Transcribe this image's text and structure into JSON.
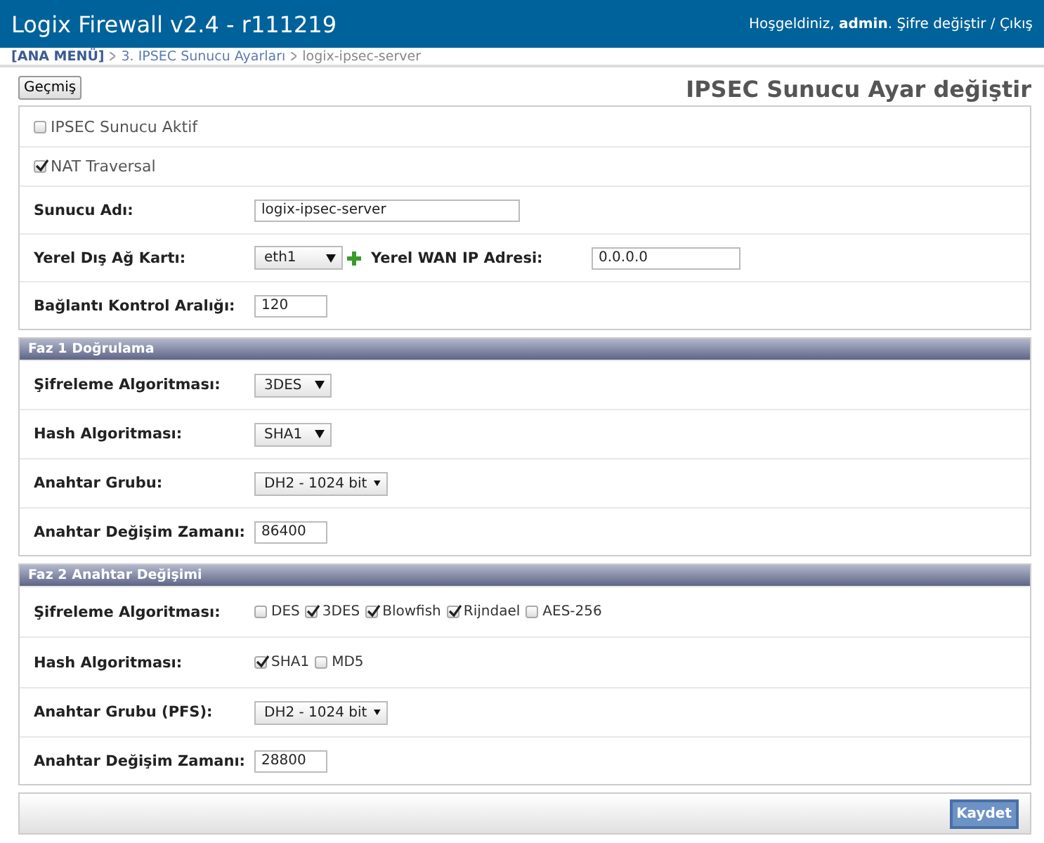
{
  "header": {
    "title": "Logix Firewall v2.4 - r111219",
    "greeting": "Hoşgeldiniz, ",
    "user": "admin",
    "user_suffix": ".",
    "change_password": "Şifre değiştir",
    "separator": "/",
    "logout": "Çıkış"
  },
  "breadcrumb": [
    {
      "label": "[ANA MENÜ]",
      "kind": "root"
    },
    {
      "label": "3. IPSEC Sunucu Ayarları",
      "kind": "link"
    },
    {
      "label": "logix-ipsec-server",
      "kind": "current"
    }
  ],
  "history_button": "Geçmiş",
  "page_title": "IPSEC Sunucu Ayar değiştir",
  "sections": [
    {
      "rows": [
        {
          "kind": "checkbox",
          "label": "IPSEC Sunucu Aktif",
          "checked": false
        },
        {
          "kind": "checkbox",
          "label": "NAT Traversal",
          "checked": true
        },
        {
          "kind": "text",
          "label": "Sunucu Adı:",
          "value": "logix-ipsec-server"
        },
        {
          "kind": "select_pair",
          "label": "Yerel Dış Ağ Kartı:",
          "value": "eth1",
          "second_label": "Yerel WAN IP Adresi:",
          "second_value": "0.0.0.0"
        },
        {
          "kind": "text",
          "label": "Bağlantı Kontrol Aralığı:",
          "value": "120"
        }
      ]
    },
    {
      "title": "Faz 1 Doğrulama",
      "rows": [
        {
          "kind": "select",
          "label": "Şifreleme Algoritması:",
          "value": "3DES"
        },
        {
          "kind": "select",
          "label": "Hash Algoritması:",
          "value": "SHA1"
        },
        {
          "kind": "select",
          "label": "Anahtar Grubu:",
          "value": "DH2 - 1024 bit"
        },
        {
          "kind": "text",
          "label": "Anahtar Değişim Zamanı:",
          "value": "86400"
        }
      ]
    },
    {
      "title": "Faz 2 Anahtar Değişimi",
      "rows": [
        {
          "kind": "checks",
          "label": "Şifreleme Algoritması:",
          "options": [
            {
              "label": "DES",
              "checked": false
            },
            {
              "label": "3DES",
              "checked": true
            },
            {
              "label": "Blowfish",
              "checked": true
            },
            {
              "label": "Rijndael",
              "checked": true
            },
            {
              "label": "AES-256",
              "checked": false
            }
          ]
        },
        {
          "kind": "checks",
          "label": "Hash Algoritması:",
          "options": [
            {
              "label": "SHA1",
              "checked": true
            },
            {
              "label": "MD5",
              "checked": false
            }
          ]
        },
        {
          "kind": "select",
          "label": "Anahtar Grubu (PFS):",
          "value": "DH2 - 1024 bit"
        },
        {
          "kind": "text",
          "label": "Anahtar Değişim Zamanı:",
          "value": "28800"
        }
      ]
    }
  ],
  "save_button": "Kaydet"
}
